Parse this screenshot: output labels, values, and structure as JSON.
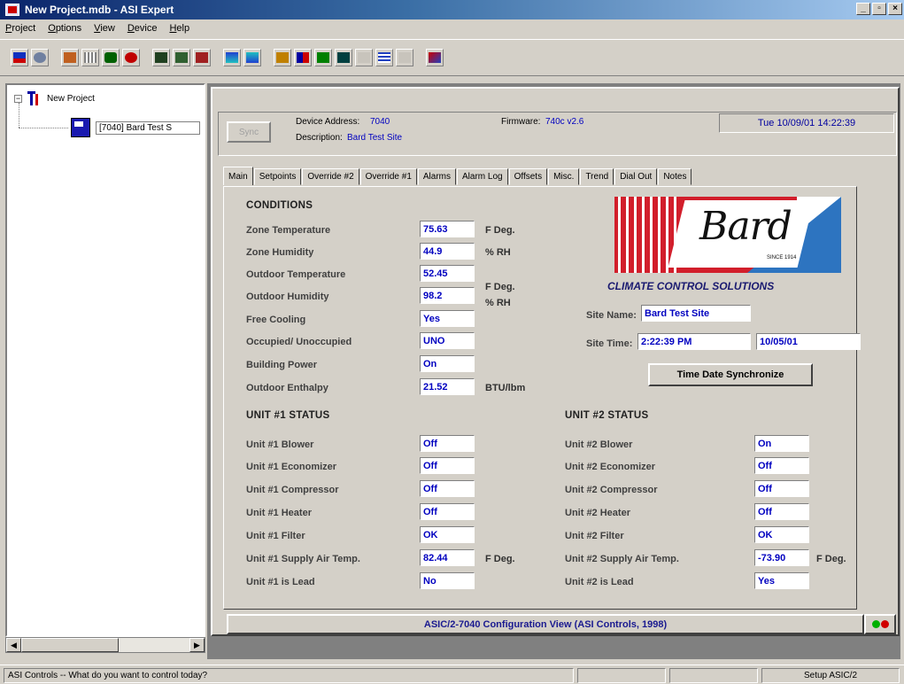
{
  "window": {
    "title": "New Project.mdb - ASI Expert",
    "min": "_",
    "max": "▫",
    "close": "×"
  },
  "menu": [
    "Project",
    "Options",
    "View",
    "Device",
    "Help"
  ],
  "tree": {
    "root": "New Project",
    "child": "[7040] Bard Test S"
  },
  "header": {
    "sync_label": "Sync",
    "device_address_label": "Device Address:",
    "device_address": "7040",
    "firmware_label": "Firmware:",
    "firmware": "740c v2.6",
    "description_label": "Description:",
    "description": "Bard Test Site",
    "datetime": "Tue 10/09/01  14:22:39"
  },
  "tabs": [
    "Main",
    "Setpoints",
    "Override #2",
    "Override #1",
    "Alarms",
    "Alarm Log",
    "Offsets",
    "Misc.",
    "Trend",
    "Dial Out",
    "Notes"
  ],
  "conditions": {
    "title": "CONDITIONS",
    "rows": [
      {
        "label": "Zone Temperature",
        "value": "75.63"
      },
      {
        "label": "Zone Humidity",
        "value": "44.9"
      },
      {
        "label": "Outdoor Temperature",
        "value": "52.45"
      },
      {
        "label": "Outdoor Humidity",
        "value": "98.2"
      },
      {
        "label": "Free Cooling",
        "value": "Yes"
      },
      {
        "label": "Occupied/ Unoccupied",
        "value": "UNO"
      },
      {
        "label": "Building Power",
        "value": "On"
      },
      {
        "label": "Outdoor Enthalpy",
        "value": "21.52"
      }
    ],
    "units": {
      "zone_temp": "F Deg.",
      "zone_hum": "% RH",
      "out_temp": "F Deg.",
      "out_hum": "% RH",
      "enthalpy": "BTU/lbm"
    }
  },
  "logo": {
    "word": "Bard",
    "since": "SINCE 1914",
    "tagline": "CLIMATE CONTROL SOLUTIONS"
  },
  "site": {
    "name_label": "Site Name:",
    "name": "Bard Test Site",
    "time_label": "Site Time:",
    "time": "2:22:39 PM",
    "date": "10/05/01",
    "sync_button": "Time Date Synchronize"
  },
  "unit1": {
    "title": "UNIT #1 STATUS",
    "rows": [
      {
        "label": "Unit #1 Blower",
        "value": "Off"
      },
      {
        "label": "Unit #1 Economizer",
        "value": "Off"
      },
      {
        "label": "Unit #1 Compressor",
        "value": "Off"
      },
      {
        "label": "Unit #1 Heater",
        "value": "Off"
      },
      {
        "label": "Unit #1 Filter",
        "value": "OK"
      },
      {
        "label": "Unit #1 Supply Air Temp.",
        "value": "82.44"
      },
      {
        "label": "Unit #1 is Lead",
        "value": "No"
      }
    ],
    "unit": "F Deg."
  },
  "unit2": {
    "title": "UNIT #2 STATUS",
    "rows": [
      {
        "label": "Unit #2 Blower",
        "value": "On"
      },
      {
        "label": "Unit #2 Economizer",
        "value": "Off"
      },
      {
        "label": "Unit #2 Compressor",
        "value": "Off"
      },
      {
        "label": "Unit #2 Heater",
        "value": "Off"
      },
      {
        "label": "Unit #2 Filter",
        "value": "OK"
      },
      {
        "label": "Unit #2 Supply Air Temp.",
        "value": "-73.90"
      },
      {
        "label": "Unit #2 is Lead",
        "value": "Yes"
      }
    ],
    "unit": "F Deg."
  },
  "banner": "ASIC/2-7040 Configuration View (ASI Controls, 1998)",
  "status": {
    "message": "ASI Controls -- What do you want to control today?",
    "right": "Setup ASIC/2"
  },
  "colors": {
    "accent": "#0a246a",
    "value_text": "#0000c0",
    "led_green": "#00b000",
    "led_red": "#d00000"
  }
}
